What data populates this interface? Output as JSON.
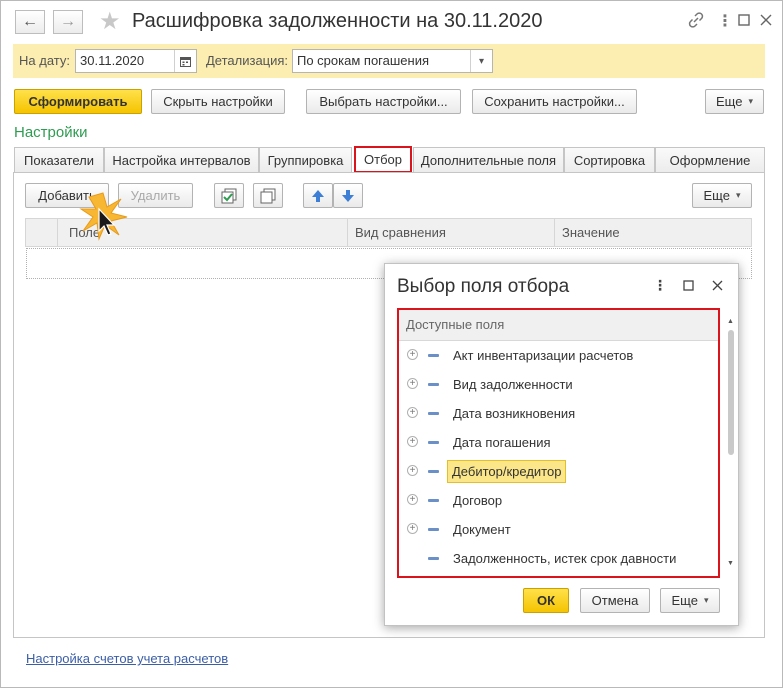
{
  "window": {
    "title": "Расшифровка задолженности на 30.11.2020",
    "back_icon": "arrow-left",
    "forward_icon": "arrow-right",
    "favorite_icon": "star",
    "link_icon": "link",
    "menu_icon": "more-vertical",
    "maximize_icon": "square",
    "close_icon": "close"
  },
  "params": {
    "date_label": "На дату:",
    "date_value": "30.11.2020",
    "detail_label": "Детализация:",
    "detail_value": "По срокам погашения"
  },
  "toolbar": {
    "generate": "Сформировать",
    "hide_settings": "Скрыть настройки",
    "choose_settings": "Выбрать настройки...",
    "save_settings": "Сохранить настройки...",
    "more": "Еще"
  },
  "settings": {
    "title": "Настройки",
    "tabs": [
      {
        "label": "Показатели"
      },
      {
        "label": "Настройка интервалов"
      },
      {
        "label": "Группировка"
      },
      {
        "label": "Отбор"
      },
      {
        "label": "Дополнительные поля"
      },
      {
        "label": "Сортировка"
      },
      {
        "label": "Оформление"
      }
    ],
    "active_tab": "Отбор"
  },
  "filter_panel": {
    "add": "Добавить",
    "delete": "Удалить",
    "more": "Еще",
    "columns": [
      "Поле",
      "Вид сравнения",
      "Значение"
    ]
  },
  "dialog": {
    "title": "Выбор поля отбора",
    "list_header": "Доступные поля",
    "items": [
      {
        "label": "Акт инвентаризации расчетов",
        "expandable": true
      },
      {
        "label": "Вид задолженности",
        "expandable": true
      },
      {
        "label": "Дата возникновения",
        "expandable": true
      },
      {
        "label": "Дата погашения",
        "expandable": true
      },
      {
        "label": "Дебитор/кредитор",
        "expandable": true,
        "selected": true
      },
      {
        "label": "Договор",
        "expandable": true
      },
      {
        "label": "Документ",
        "expandable": true
      },
      {
        "label": "Задолженность, истек срок давности",
        "expandable": false
      }
    ],
    "ok": "ОК",
    "cancel": "Отмена",
    "more": "Еще"
  },
  "footer": {
    "link": "Настройка счетов учета расчетов"
  },
  "colors": {
    "accent_green": "#2f9c52",
    "highlight_red": "#d9141c",
    "primary_yellow": "#f5c400",
    "param_bar": "#fbeeb0"
  }
}
